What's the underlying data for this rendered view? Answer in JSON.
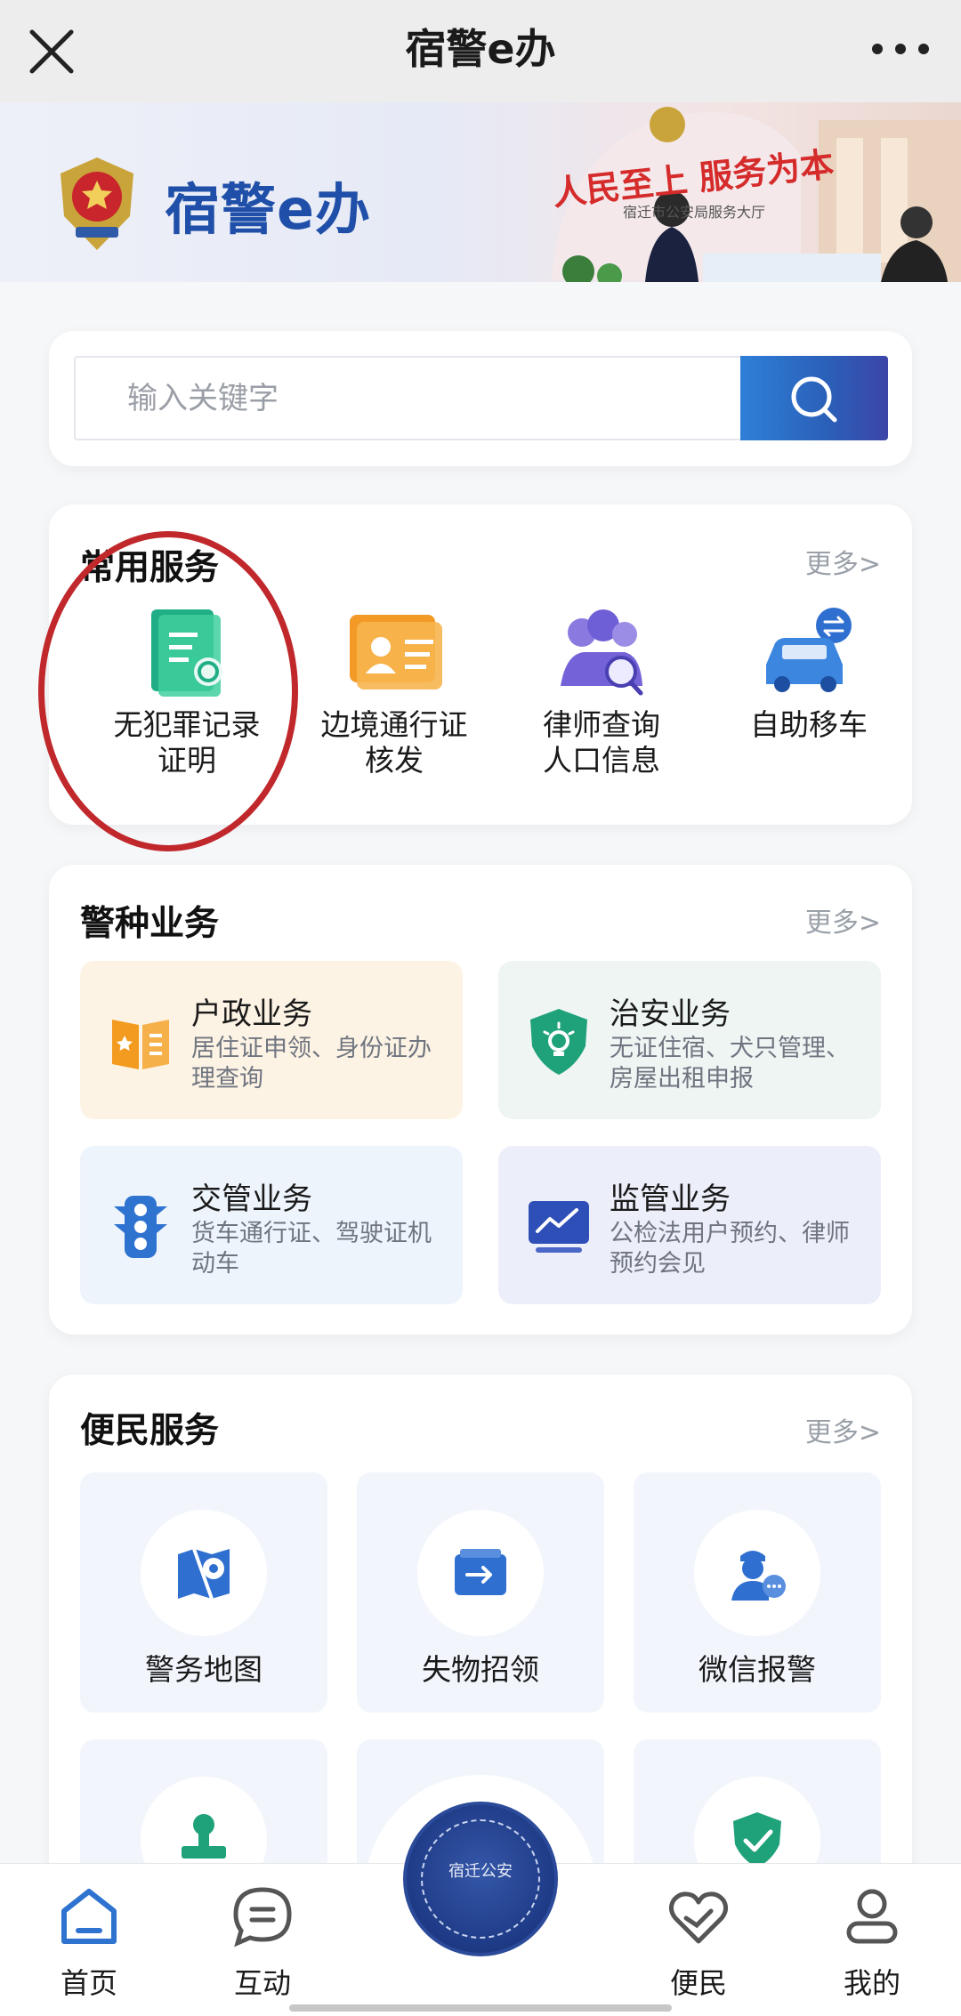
{
  "topbar": {
    "title": "宿警e办",
    "close_icon": "close-icon",
    "more_icon": "more-dots-icon"
  },
  "banner": {
    "brand": "宿警e办",
    "slogan_left": "人民至上",
    "slogan_right": "服务为本",
    "sub": "宿迁市公安局服务大厅"
  },
  "search": {
    "placeholder": "输入关键字",
    "value": ""
  },
  "common": {
    "title": "常用服务",
    "more": "更多>",
    "items": [
      {
        "line1": "无犯罪记录",
        "line2": "证明",
        "icon": "certificate-icon"
      },
      {
        "line1": "边境通行证",
        "line2": "核发",
        "icon": "id-card-icon"
      },
      {
        "line1": "律师查询",
        "line2": "人口信息",
        "icon": "people-search-icon"
      },
      {
        "line1": "自助移车",
        "line2": "",
        "icon": "car-icon"
      }
    ]
  },
  "police": {
    "title": "警种业务",
    "more": "更多>",
    "items": [
      {
        "title": "户政业务",
        "desc": "居住证申领、身份证办理查询",
        "icon": "book-icon"
      },
      {
        "title": "治安业务",
        "desc": "无证住宿、犬只管理、房屋出租申报",
        "icon": "shield-icon"
      },
      {
        "title": "交管业务",
        "desc": "货车通行证、驾驶证机动车",
        "icon": "traffic-light-icon"
      },
      {
        "title": "监管业务",
        "desc": "公检法用户预约、律师预约会见",
        "icon": "monitor-chart-icon"
      }
    ]
  },
  "convenience": {
    "title": "便民服务",
    "more": "更多>",
    "items": [
      {
        "label": "警务地图",
        "icon": "map-icon"
      },
      {
        "label": "失物招领",
        "icon": "wallet-icon"
      },
      {
        "label": "微信报警",
        "icon": "officer-chat-icon"
      }
    ]
  },
  "nav": {
    "items": [
      {
        "label": "首页",
        "icon": "home-icon",
        "active": true
      },
      {
        "label": "互动",
        "icon": "chat-icon"
      },
      {
        "label": "便民",
        "icon": "heart-hand-icon"
      },
      {
        "label": "我的",
        "icon": "user-icon"
      }
    ],
    "center_badge": "宿迁公安"
  }
}
